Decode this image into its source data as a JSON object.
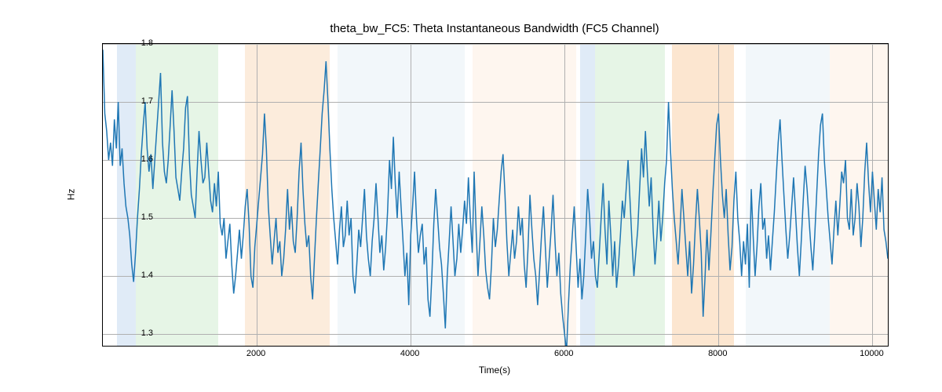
{
  "chart_data": {
    "type": "line",
    "title": "theta_bw_FC5: Theta Instantaneous Bandwidth (FC5 Channel)",
    "xlabel": "Time(s)",
    "ylabel": "Hz",
    "xlim": [
      0,
      10200
    ],
    "ylim": [
      1.28,
      1.8
    ],
    "xticks": [
      2000,
      4000,
      6000,
      8000,
      10000
    ],
    "yticks": [
      1.3,
      1.4,
      1.5,
      1.6,
      1.7,
      1.8
    ],
    "bands": [
      {
        "x0": 180,
        "x1": 430,
        "color": "#a7c7e7"
      },
      {
        "x0": 430,
        "x1": 1500,
        "color": "#b7e1b7"
      },
      {
        "x0": 1850,
        "x1": 2950,
        "color": "#f7c99b"
      },
      {
        "x0": 3050,
        "x1": 4700,
        "color": "#dbe7f2"
      },
      {
        "x0": 4800,
        "x1": 6150,
        "color": "#fbe6d2"
      },
      {
        "x0": 6200,
        "x1": 6400,
        "color": "#a7c7e7"
      },
      {
        "x0": 6400,
        "x1": 7300,
        "color": "#b7e1b7"
      },
      {
        "x0": 7400,
        "x1": 8200,
        "color": "#f7b878"
      },
      {
        "x0": 8350,
        "x1": 9450,
        "color": "#dbe7f2"
      },
      {
        "x0": 9450,
        "x1": 10200,
        "color": "#fbe6d2"
      }
    ],
    "series": [
      {
        "name": "theta_bw_FC5",
        "color": "#1f77b4",
        "x_step": 25,
        "values": [
          1.79,
          1.68,
          1.65,
          1.6,
          1.63,
          1.59,
          1.67,
          1.62,
          1.7,
          1.59,
          1.62,
          1.56,
          1.52,
          1.5,
          1.47,
          1.42,
          1.39,
          1.44,
          1.5,
          1.55,
          1.61,
          1.66,
          1.7,
          1.62,
          1.58,
          1.61,
          1.55,
          1.6,
          1.65,
          1.7,
          1.75,
          1.63,
          1.58,
          1.56,
          1.6,
          1.66,
          1.72,
          1.65,
          1.57,
          1.55,
          1.53,
          1.58,
          1.62,
          1.69,
          1.71,
          1.6,
          1.54,
          1.52,
          1.5,
          1.58,
          1.65,
          1.6,
          1.56,
          1.57,
          1.63,
          1.58,
          1.53,
          1.51,
          1.56,
          1.52,
          1.58,
          1.49,
          1.47,
          1.5,
          1.43,
          1.46,
          1.49,
          1.42,
          1.37,
          1.4,
          1.44,
          1.48,
          1.43,
          1.47,
          1.52,
          1.55,
          1.49,
          1.4,
          1.38,
          1.45,
          1.49,
          1.53,
          1.57,
          1.61,
          1.68,
          1.62,
          1.52,
          1.47,
          1.42,
          1.46,
          1.5,
          1.44,
          1.46,
          1.4,
          1.43,
          1.48,
          1.55,
          1.48,
          1.52,
          1.46,
          1.44,
          1.5,
          1.58,
          1.63,
          1.55,
          1.49,
          1.45,
          1.47,
          1.4,
          1.36,
          1.43,
          1.5,
          1.56,
          1.62,
          1.68,
          1.72,
          1.77,
          1.7,
          1.62,
          1.55,
          1.5,
          1.46,
          1.42,
          1.48,
          1.52,
          1.45,
          1.47,
          1.53,
          1.47,
          1.5,
          1.4,
          1.37,
          1.42,
          1.48,
          1.45,
          1.5,
          1.55,
          1.47,
          1.43,
          1.4,
          1.46,
          1.5,
          1.56,
          1.5,
          1.44,
          1.47,
          1.41,
          1.45,
          1.51,
          1.6,
          1.55,
          1.64,
          1.56,
          1.5,
          1.58,
          1.52,
          1.46,
          1.4,
          1.44,
          1.35,
          1.47,
          1.52,
          1.58,
          1.5,
          1.44,
          1.47,
          1.49,
          1.42,
          1.45,
          1.36,
          1.33,
          1.4,
          1.49,
          1.55,
          1.5,
          1.45,
          1.42,
          1.37,
          1.31,
          1.4,
          1.46,
          1.52,
          1.46,
          1.4,
          1.43,
          1.49,
          1.44,
          1.48,
          1.53,
          1.49,
          1.57,
          1.5,
          1.44,
          1.58,
          1.48,
          1.4,
          1.46,
          1.52,
          1.47,
          1.41,
          1.38,
          1.36,
          1.42,
          1.5,
          1.45,
          1.48,
          1.53,
          1.58,
          1.61,
          1.54,
          1.46,
          1.4,
          1.44,
          1.48,
          1.43,
          1.46,
          1.52,
          1.47,
          1.5,
          1.42,
          1.38,
          1.45,
          1.54,
          1.48,
          1.43,
          1.4,
          1.35,
          1.41,
          1.47,
          1.52,
          1.45,
          1.38,
          1.43,
          1.48,
          1.54,
          1.46,
          1.4,
          1.44,
          1.37,
          1.33,
          1.3,
          1.27,
          1.35,
          1.42,
          1.47,
          1.52,
          1.45,
          1.38,
          1.43,
          1.36,
          1.4,
          1.47,
          1.55,
          1.5,
          1.43,
          1.46,
          1.4,
          1.38,
          1.44,
          1.5,
          1.56,
          1.48,
          1.42,
          1.53,
          1.47,
          1.4,
          1.46,
          1.38,
          1.42,
          1.47,
          1.53,
          1.5,
          1.55,
          1.6,
          1.53,
          1.46,
          1.4,
          1.44,
          1.48,
          1.55,
          1.62,
          1.57,
          1.65,
          1.58,
          1.52,
          1.57,
          1.48,
          1.42,
          1.47,
          1.53,
          1.46,
          1.5,
          1.56,
          1.6,
          1.7,
          1.62,
          1.55,
          1.5,
          1.46,
          1.42,
          1.48,
          1.55,
          1.5,
          1.45,
          1.4,
          1.46,
          1.37,
          1.42,
          1.49,
          1.55,
          1.5,
          1.44,
          1.33,
          1.4,
          1.48,
          1.41,
          1.47,
          1.54,
          1.6,
          1.66,
          1.68,
          1.6,
          1.54,
          1.5,
          1.55,
          1.47,
          1.41,
          1.45,
          1.53,
          1.58,
          1.5,
          1.46,
          1.4,
          1.46,
          1.42,
          1.49,
          1.38,
          1.55,
          1.47,
          1.4,
          1.45,
          1.52,
          1.56,
          1.48,
          1.5,
          1.43,
          1.47,
          1.41,
          1.46,
          1.51,
          1.57,
          1.63,
          1.67,
          1.6,
          1.54,
          1.48,
          1.43,
          1.47,
          1.52,
          1.57,
          1.51,
          1.45,
          1.4,
          1.46,
          1.53,
          1.59,
          1.55,
          1.5,
          1.45,
          1.41,
          1.47,
          1.54,
          1.61,
          1.66,
          1.68,
          1.6,
          1.55,
          1.5,
          1.46,
          1.42,
          1.48,
          1.53,
          1.47,
          1.52,
          1.58,
          1.56,
          1.6,
          1.5,
          1.48,
          1.55,
          1.47,
          1.5,
          1.56,
          1.52,
          1.45,
          1.5,
          1.58,
          1.63,
          1.56,
          1.51,
          1.58,
          1.53,
          1.48,
          1.55,
          1.51,
          1.57,
          1.48,
          1.46,
          1.43
        ]
      }
    ]
  }
}
